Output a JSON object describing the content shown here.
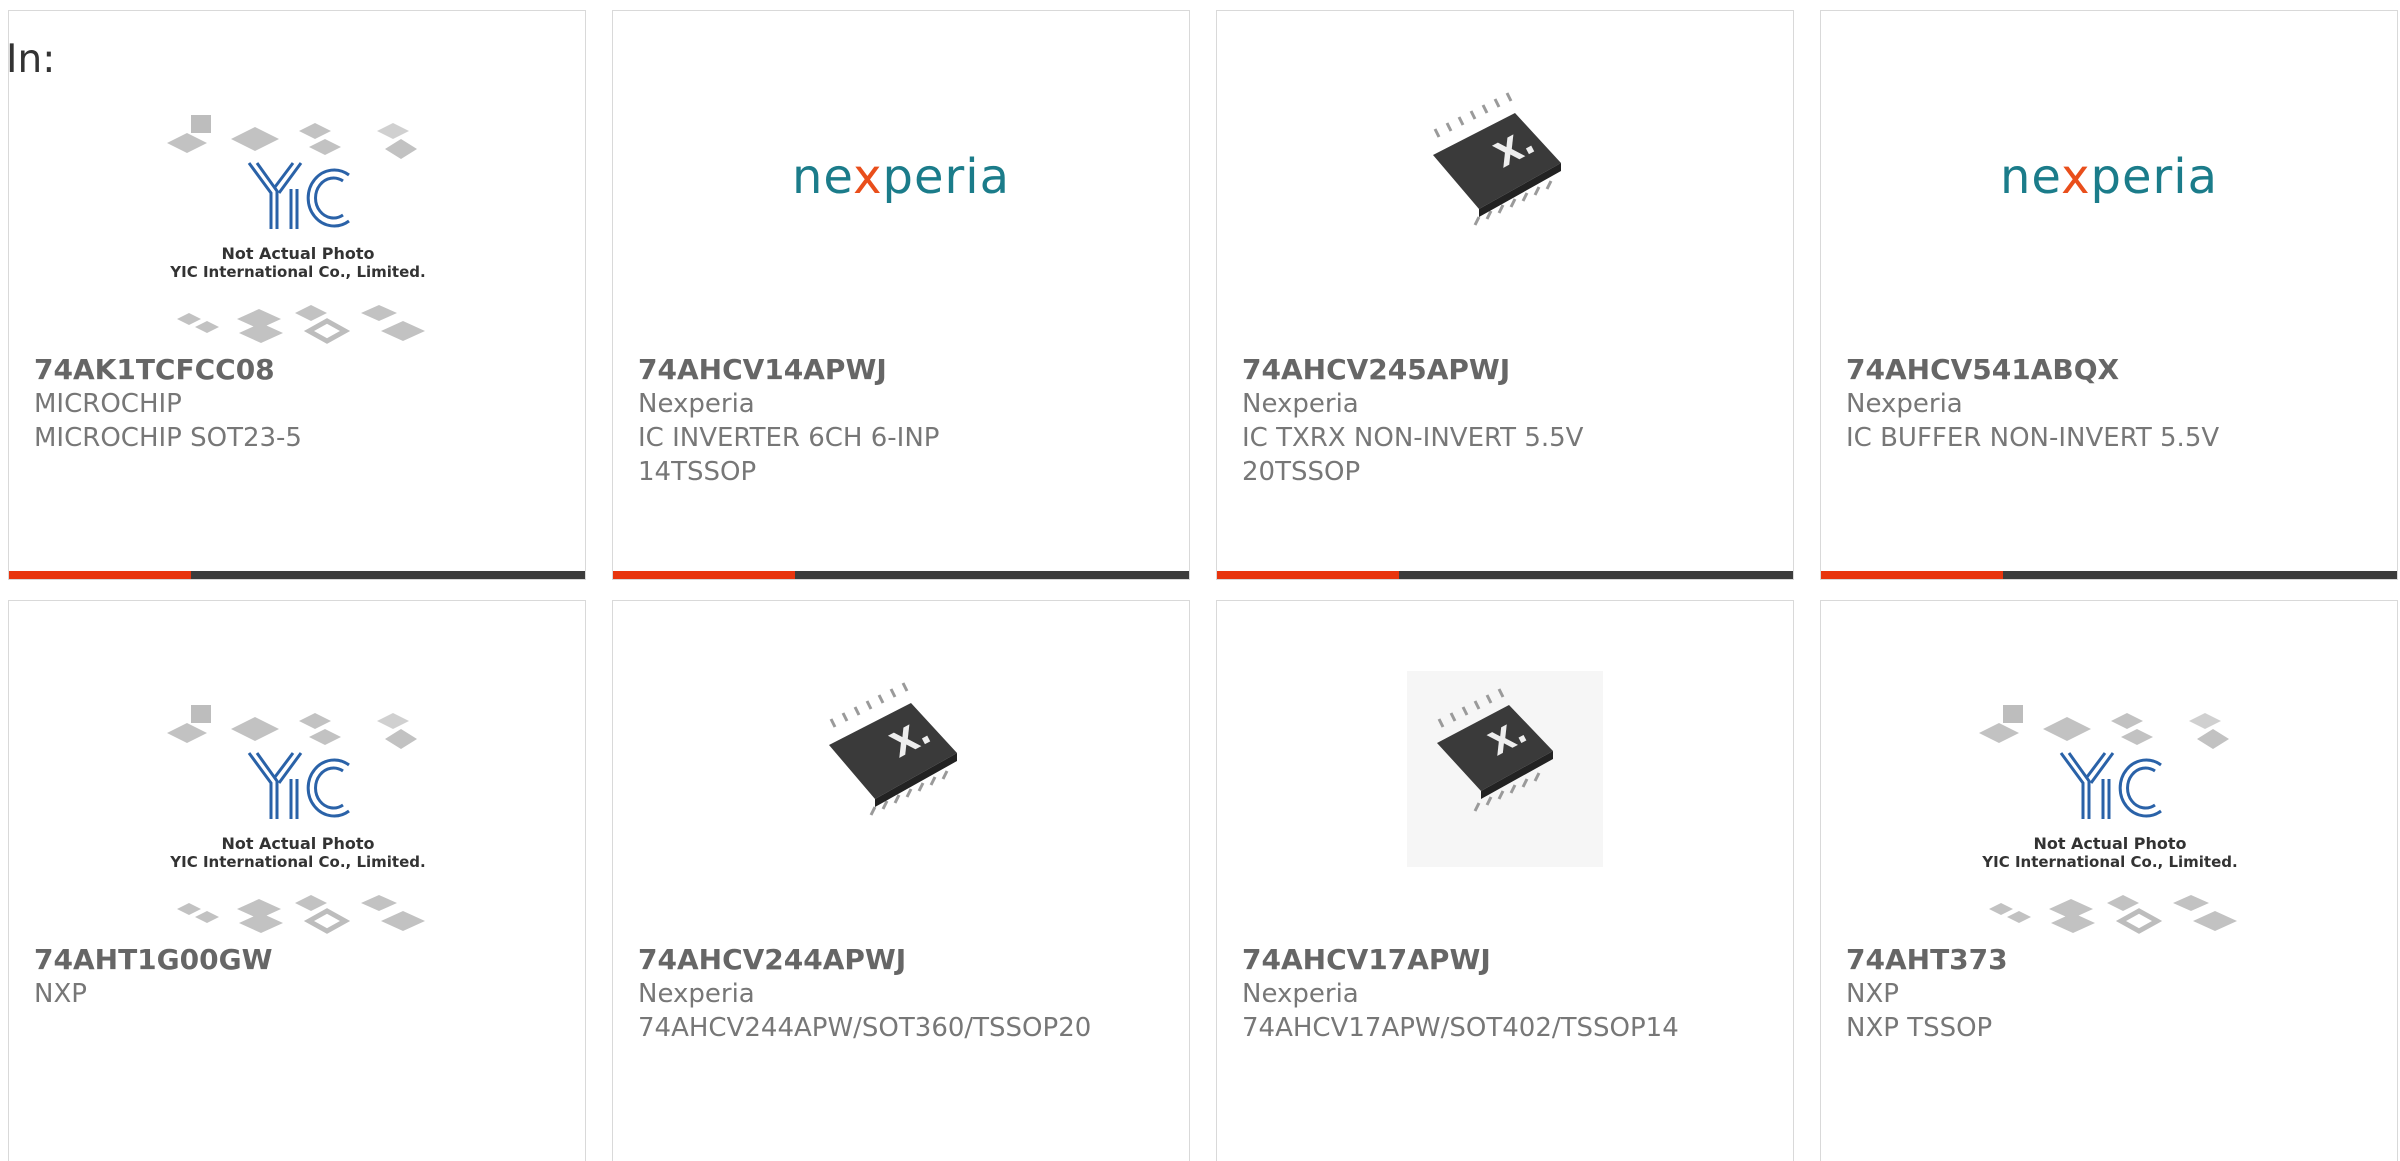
{
  "header": {
    "in_label": "In:"
  },
  "brand": {
    "accent_color": "#e8350e",
    "bar_color": "#3c3c3c",
    "nexperia_teal": "#1b7c8a",
    "nexperia_orange": "#e94e1b"
  },
  "placeholder": {
    "line1": "Not Actual Photo",
    "line2": "YIC International Co., Limited."
  },
  "nexperia_logo": {
    "pre": "ne",
    "x": "x",
    "post": "peria"
  },
  "products": [
    {
      "part": "74AK1TCFCC08",
      "maker": "MICROCHIP",
      "desc1": "MICROCHIP SOT23-5",
      "desc2": "",
      "image": "yic-placeholder"
    },
    {
      "part": "74AHCV14APWJ",
      "maker": "Nexperia",
      "desc1": "IC INVERTER 6CH 6-INP",
      "desc2": "14TSSOP",
      "image": "nexperia-logo"
    },
    {
      "part": "74AHCV245APWJ",
      "maker": "Nexperia",
      "desc1": "IC TXRX NON-INVERT 5.5V",
      "desc2": "20TSSOP",
      "image": "chip-photo"
    },
    {
      "part": "74AHCV541ABQX",
      "maker": "Nexperia",
      "desc1": "IC BUFFER NON-INVERT 5.5V",
      "desc2": "",
      "image": "nexperia-logo"
    },
    {
      "part": "74AHT1G00GW",
      "maker": "NXP",
      "desc1": "",
      "desc2": "",
      "image": "yic-placeholder"
    },
    {
      "part": "74AHCV244APWJ",
      "maker": "Nexperia",
      "desc1": "74AHCV244APW/SOT360/TSSOP20",
      "desc2": "",
      "image": "chip-photo"
    },
    {
      "part": "74AHCV17APWJ",
      "maker": "Nexperia",
      "desc1": "74AHCV17APW/SOT402/TSSOP14",
      "desc2": "",
      "image": "chip-photo"
    },
    {
      "part": "74AHT373",
      "maker": "NXP",
      "desc1": "NXP TSSOP",
      "desc2": "",
      "image": "yic-placeholder"
    }
  ]
}
